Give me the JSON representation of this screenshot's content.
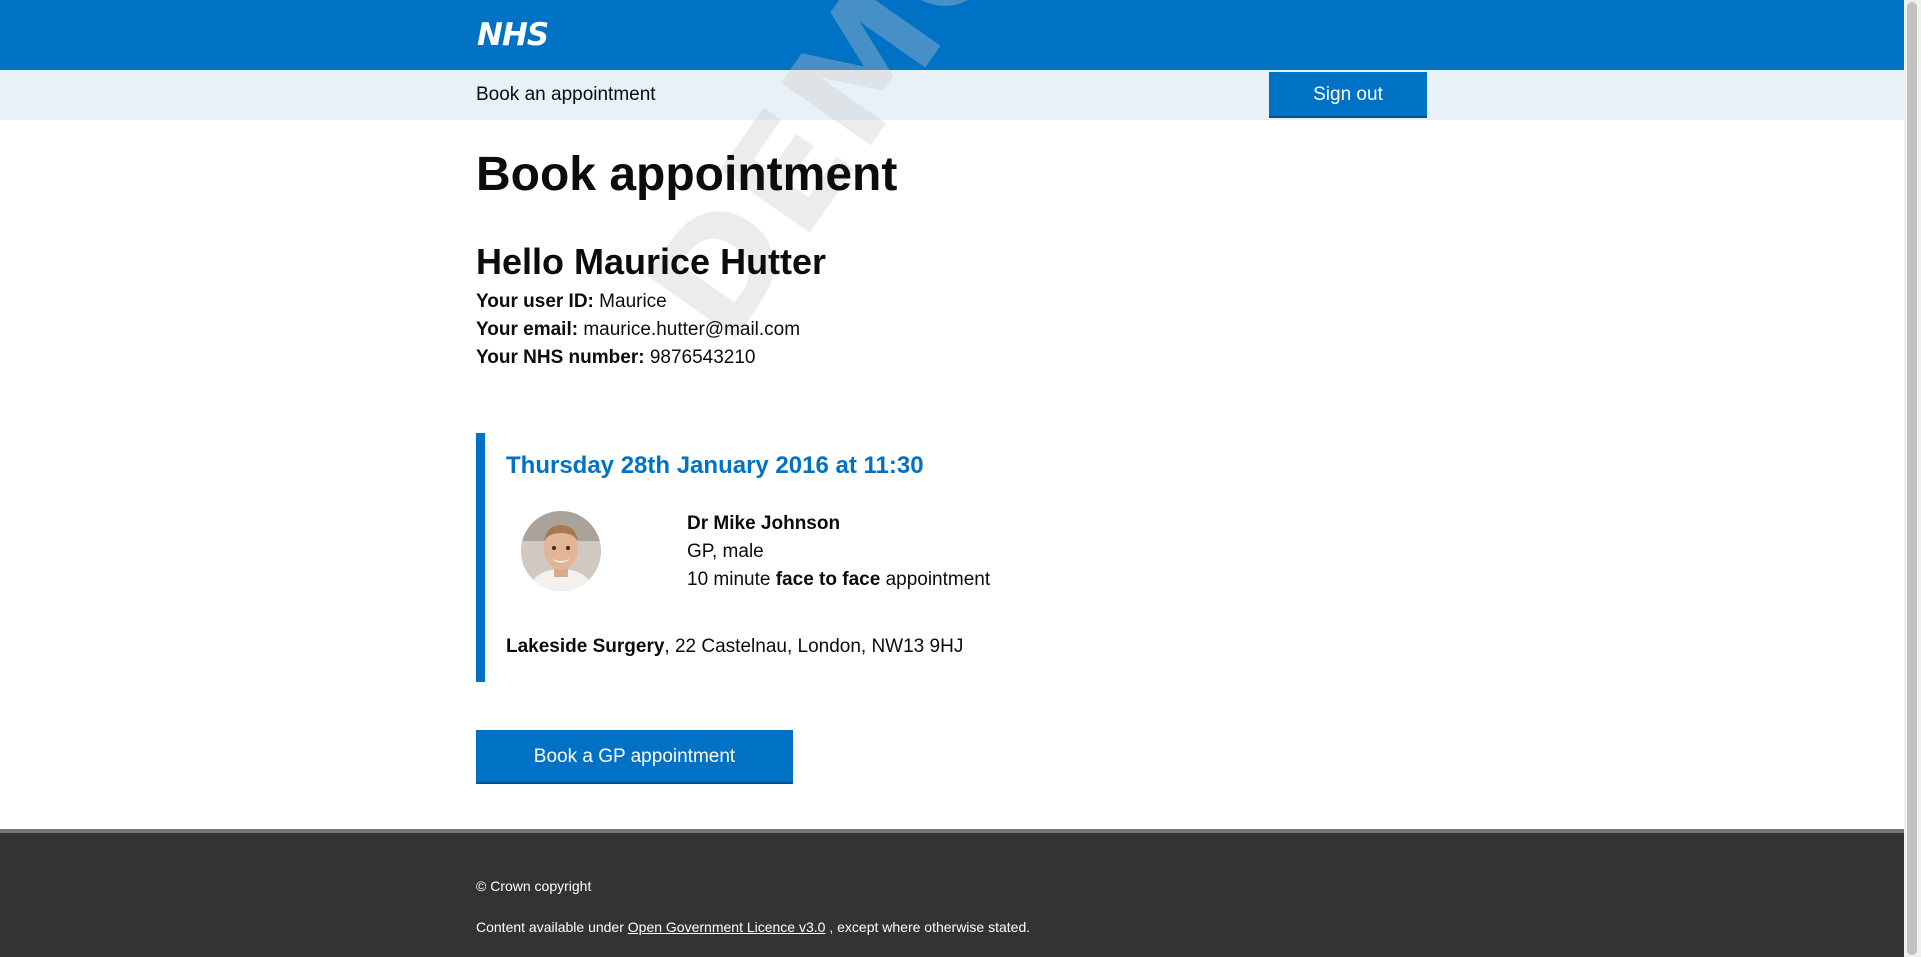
{
  "header": {
    "logo": "NHS"
  },
  "subnav": {
    "title": "Book an appointment",
    "signout_label": "Sign out"
  },
  "watermark": "DEMO",
  "main": {
    "title": "Book appointment",
    "greeting": "Hello Maurice Hutter",
    "user_id_label": "Your user ID:",
    "user_id": "Maurice",
    "email_label": "Your email:",
    "email": "maurice.hutter@mail.com",
    "nhs_number_label": "Your NHS number:",
    "nhs_number": "9876543210"
  },
  "appointment": {
    "date": "Thursday 28th January 2016 at 11:30",
    "doctor_name": "Dr Mike Johnson",
    "doctor_role": "GP, male",
    "duration": "10 minute",
    "mode": "face to face",
    "mode_suffix": "appointment",
    "surgery_name": "Lakeside Surgery",
    "surgery_address": ", 22 Castelnau, London, NW13 9HJ"
  },
  "book_button_label": "Book a GP appointment",
  "footer": {
    "copyright": "© Crown copyright",
    "licence_prefix": "Content available under",
    "licence_link": "Open Government Licence v3.0",
    "licence_suffix": ", except where otherwise stated."
  },
  "colors": {
    "nhs_blue": "#0072c6",
    "footer_bg": "#333333",
    "subnav_bg": "#e8f1f8"
  }
}
